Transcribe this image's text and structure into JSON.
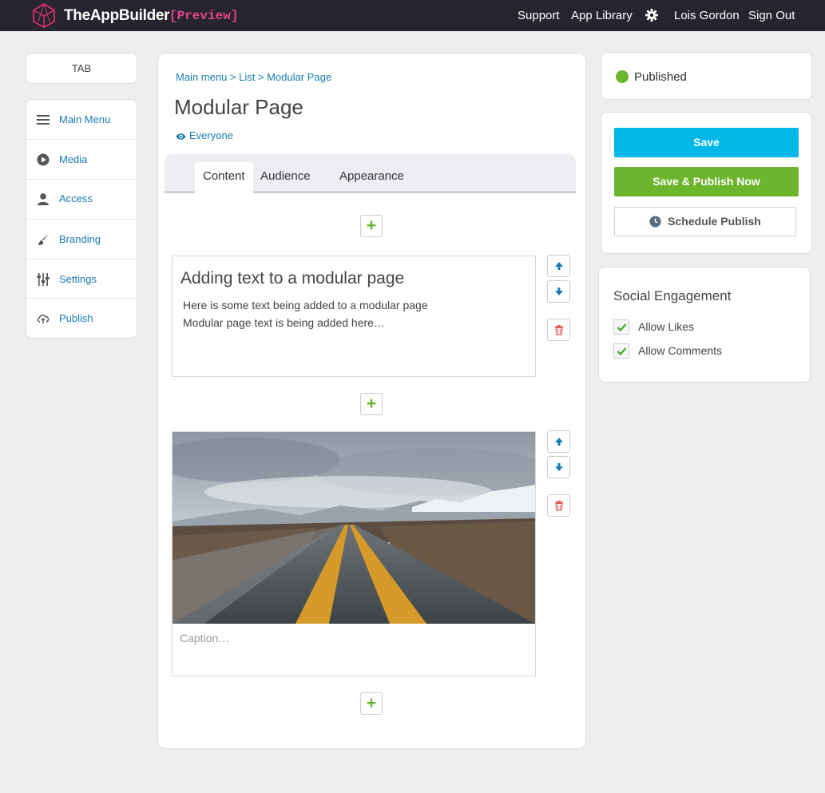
{
  "header": {
    "brand": "TheAppBuilder",
    "preview": "[Preview]",
    "nav": {
      "support": "Support",
      "app_library": "App Library",
      "user": "Lois Gordon",
      "sign_out": "Sign Out"
    },
    "icons": [
      "app-builder-logo",
      "gear-icon"
    ]
  },
  "sidebar": {
    "tab_label": "TAB",
    "items": [
      {
        "label": "Main Menu",
        "icon": "menu-icon"
      },
      {
        "label": "Media",
        "icon": "play-icon"
      },
      {
        "label": "Access",
        "icon": "user-icon"
      },
      {
        "label": "Branding",
        "icon": "brush-icon"
      },
      {
        "label": "Settings",
        "icon": "sliders-icon"
      },
      {
        "label": "Publish",
        "icon": "cloud-upload-icon"
      }
    ]
  },
  "main": {
    "breadcrumb": "Main menu > List > Modular Page",
    "title": "Modular Page",
    "audience": "Everyone",
    "tabs": [
      {
        "label": "Content",
        "active": true
      },
      {
        "label": "Audience",
        "active": false
      },
      {
        "label": "Appearance",
        "active": false
      }
    ],
    "text_module": {
      "heading": "Adding text to a modular page",
      "lines": [
        "Here is some text being added to a modular page",
        "Modular page text is being added here…"
      ]
    },
    "image_module": {
      "caption_placeholder": "Caption…"
    },
    "add_symbol": "+"
  },
  "right": {
    "status": "Published",
    "status_color": "#6cb52d",
    "buttons": {
      "save": "Save",
      "save_publish": "Save & Publish Now",
      "schedule": "Schedule Publish"
    },
    "social": {
      "title": "Social Engagement",
      "options": [
        {
          "label": "Allow Likes",
          "checked": true
        },
        {
          "label": "Allow Comments",
          "checked": true
        }
      ]
    }
  },
  "colors": {
    "topbar": "#26242e",
    "link": "#1a7db2",
    "save": "#00b7ea",
    "publish": "#6cb52d",
    "preview": "#e0468e",
    "delete": "#e05a5a"
  }
}
